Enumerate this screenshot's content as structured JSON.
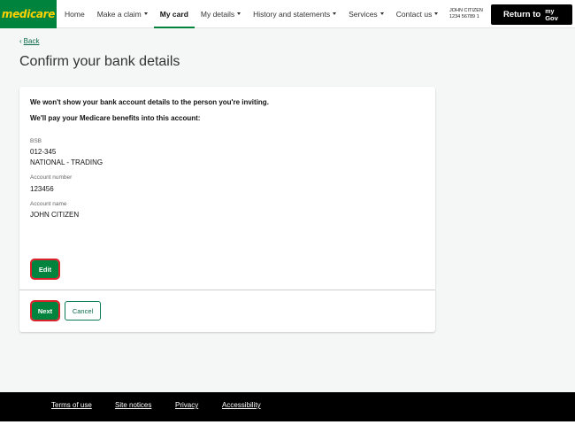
{
  "header": {
    "logo": "medicare",
    "nav": [
      {
        "label": "Home",
        "dropdown": false,
        "active": false
      },
      {
        "label": "Make a claim",
        "dropdown": true,
        "active": false
      },
      {
        "label": "My card",
        "dropdown": false,
        "active": true
      },
      {
        "label": "My details",
        "dropdown": true,
        "active": false
      },
      {
        "label": "History and statements",
        "dropdown": true,
        "active": false
      },
      {
        "label": "Services",
        "dropdown": true,
        "active": false
      },
      {
        "label": "Contact us",
        "dropdown": true,
        "active": false
      }
    ],
    "user": {
      "name": "JOHN CITIZEN",
      "number": "1234 56789 1"
    },
    "return_button": {
      "label": "Return to",
      "logo_top": "my",
      "logo_bottom": "Gov"
    }
  },
  "main": {
    "back_label": "Back",
    "title": "Confirm your bank details",
    "card": {
      "notice": "We won't show your bank account details to the person you're inviting.",
      "subnotice": "We'll pay your Medicare benefits into this account:",
      "fields": {
        "bsb_label": "BSB",
        "bsb_value": "012-345",
        "bank_name": "NATIONAL - TRADING",
        "account_number_label": "Account number",
        "account_number_value": "123456",
        "account_name_label": "Account name",
        "account_name_value": "JOHN CITIZEN"
      },
      "edit_label": "Edit",
      "next_label": "Next",
      "cancel_label": "Cancel"
    }
  },
  "footer": {
    "links": [
      "Terms of use",
      "Site notices",
      "Privacy",
      "Accessibility"
    ]
  },
  "colors": {
    "brand_green": "#00843d",
    "logo_yellow": "#ffd200",
    "highlight_red": "#d9222a",
    "footer_bg": "#000000",
    "page_bg": "#f4f7f6"
  }
}
